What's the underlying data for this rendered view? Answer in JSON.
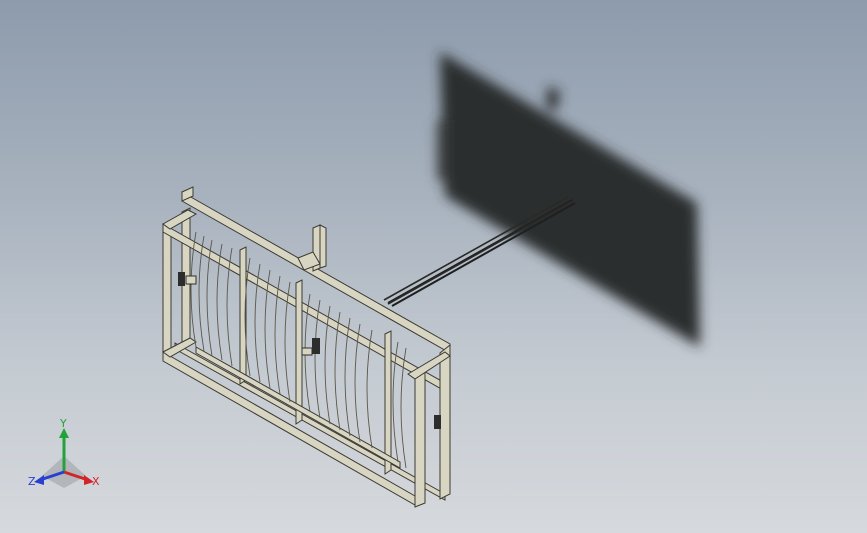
{
  "viewport": {
    "background_top": "#8d9bac",
    "background_bottom": "#d6d9dd"
  },
  "model": {
    "frame_color": "#d9d5c3",
    "edge_color": "#3a3a32",
    "shadow_color": "#2b2d2f"
  },
  "triad": {
    "x_label": "X",
    "y_label": "Y",
    "z_label": "Z",
    "x_color": "#d0262a",
    "y_color": "#23a23a",
    "z_color": "#2a3fd0"
  }
}
